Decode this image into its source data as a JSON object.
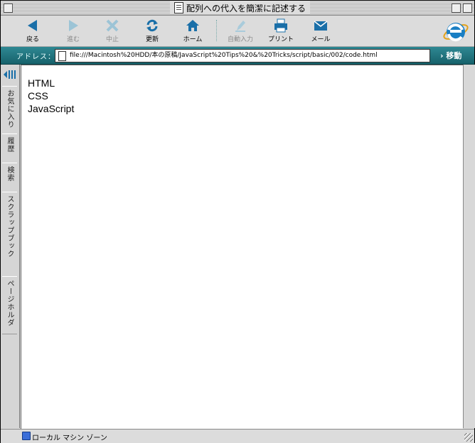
{
  "window": {
    "title": "配列への代入を簡潔に記述する"
  },
  "toolbar": {
    "buttons": [
      {
        "label": "戻る",
        "icon": "back-arrow-icon",
        "enabled": true
      },
      {
        "label": "進む",
        "icon": "forward-arrow-icon",
        "enabled": false
      },
      {
        "label": "中止",
        "icon": "stop-x-icon",
        "enabled": false
      },
      {
        "label": "更新",
        "icon": "refresh-icon",
        "enabled": true
      },
      {
        "label": "ホーム",
        "icon": "home-icon",
        "enabled": true
      },
      {
        "label": "自動入力",
        "icon": "autofill-icon",
        "enabled": false
      },
      {
        "label": "プリント",
        "icon": "printer-icon",
        "enabled": true
      },
      {
        "label": "メール",
        "icon": "mail-icon",
        "enabled": true
      }
    ]
  },
  "address": {
    "label": "アドレス：",
    "url": "file:///Macintosh%20HDD/本の原稿/JavaScript%20Tips%20&%20Tricks/script/basic/002/code.html",
    "go_label": "› 移動"
  },
  "sidebar": {
    "tabs": [
      "お気に入り",
      "履歴",
      "検索",
      "スクラップブック",
      "ページホルダ"
    ]
  },
  "content": {
    "items": [
      "HTML",
      "CSS",
      "JavaScript"
    ]
  },
  "status": {
    "zone": "ローカル マシン ゾーン"
  },
  "colors": {
    "accent": "#1f6f79",
    "icon_blue": "#1a6fa8"
  }
}
